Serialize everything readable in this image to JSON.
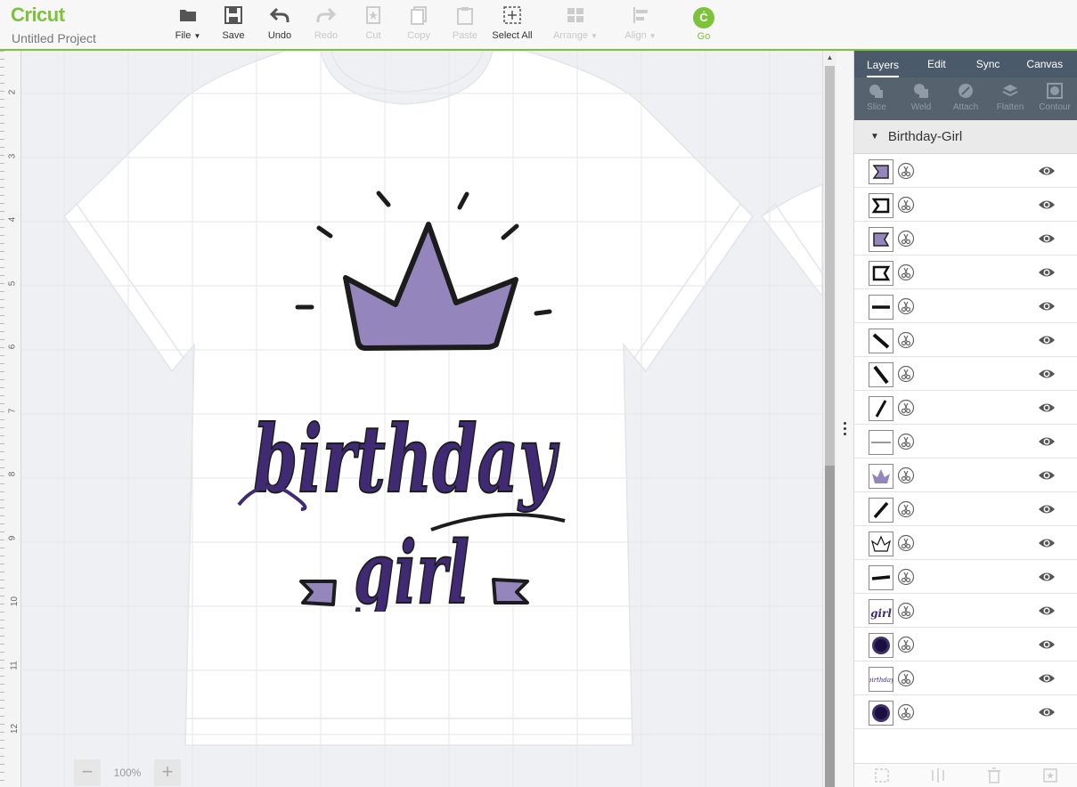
{
  "app": {
    "logo": "Cricut",
    "project_name": "Untitled Project"
  },
  "toolbar": {
    "file": "File",
    "save": "Save",
    "undo": "Undo",
    "redo": "Redo",
    "cut": "Cut",
    "copy": "Copy",
    "paste": "Paste",
    "select_all": "Select All",
    "arrange": "Arrange",
    "align": "Align",
    "go": "Go",
    "go_badge": "Ċ"
  },
  "ruler": {
    "numbers": [
      "2",
      "3",
      "4",
      "5",
      "6",
      "7",
      "8",
      "9",
      "10",
      "11",
      "12"
    ]
  },
  "zoom": {
    "minus": "−",
    "value": "100%",
    "plus": "+"
  },
  "panel": {
    "tabs": [
      "Layers",
      "Edit",
      "Sync",
      "Canvas"
    ],
    "actions": [
      "Slice",
      "Weld",
      "Attach",
      "Flatten",
      "Contour"
    ],
    "group_name": "Birthday-Girl",
    "layer_thumbs": [
      "flag-left-fill",
      "flag-left-outline",
      "flag-right-fill",
      "flag-right-outline",
      "dash-horizontal",
      "dash-diagonal",
      "dash-diagonal-2",
      "dash-diagonal-3",
      "line-thin",
      "crown-fill",
      "dash-diagonal-4",
      "crown-outline",
      "dash-horizontal-2",
      "girl-text",
      "blur-dot",
      "birthday-text",
      "blur-dot-2"
    ]
  },
  "design": {
    "word1": "birthday",
    "word2": "girl"
  },
  "colors": {
    "brand_green": "#7cc23a",
    "panel_dark": "#4b5a6a",
    "crown_purple": "#9585bd",
    "text_purple": "#3f2a73"
  }
}
